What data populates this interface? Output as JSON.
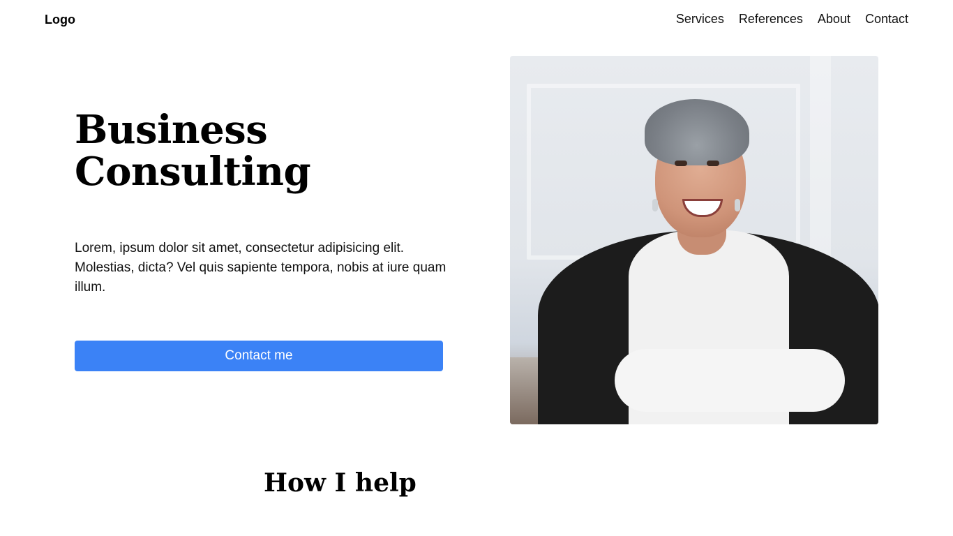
{
  "header": {
    "logo": "Logo",
    "nav": [
      {
        "label": "Services"
      },
      {
        "label": "References"
      },
      {
        "label": "About"
      },
      {
        "label": "Contact"
      }
    ]
  },
  "hero": {
    "title_line1": "Business",
    "title_line2": "Consulting",
    "text": "Lorem, ipsum dolor sit amet, consectetur adipisicing elit. Molestias, dicta? Vel quis sapiente tempora, nobis at iure quam illum.",
    "cta_label": "Contact me",
    "cta_color": "#3b82f6"
  },
  "section": {
    "title": "How I help"
  }
}
